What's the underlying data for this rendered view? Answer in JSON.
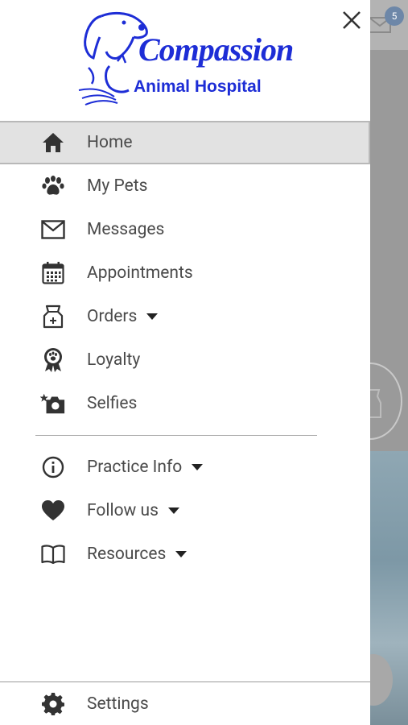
{
  "brand": {
    "title": "Compassion",
    "subtitle": "Animal Hospital",
    "color": "#1d2dd6"
  },
  "header": {
    "close_icon": "close-icon"
  },
  "background": {
    "badge_count": "5"
  },
  "nav": {
    "primary": [
      {
        "label": "Home",
        "icon": "home-icon",
        "active": true
      },
      {
        "label": "My Pets",
        "icon": "paw-icon"
      },
      {
        "label": "Messages",
        "icon": "envelope-icon"
      },
      {
        "label": "Appointments",
        "icon": "calendar-icon"
      },
      {
        "label": "Orders",
        "icon": "pet-food-icon",
        "has_dropdown": true
      },
      {
        "label": "Loyalty",
        "icon": "award-ribbon-icon"
      },
      {
        "label": "Selfies",
        "icon": "camera-icon"
      }
    ],
    "secondary": [
      {
        "label": "Practice Info",
        "icon": "info-icon",
        "has_dropdown": true
      },
      {
        "label": "Follow us",
        "icon": "heart-icon",
        "has_dropdown": true
      },
      {
        "label": "Resources",
        "icon": "book-icon",
        "has_dropdown": true
      }
    ],
    "settings": {
      "label": "Settings",
      "icon": "gear-icon"
    }
  },
  "colors": {
    "active_bg": "#e2e2e2",
    "text": "#4a4a4a",
    "icon": "#333333"
  }
}
